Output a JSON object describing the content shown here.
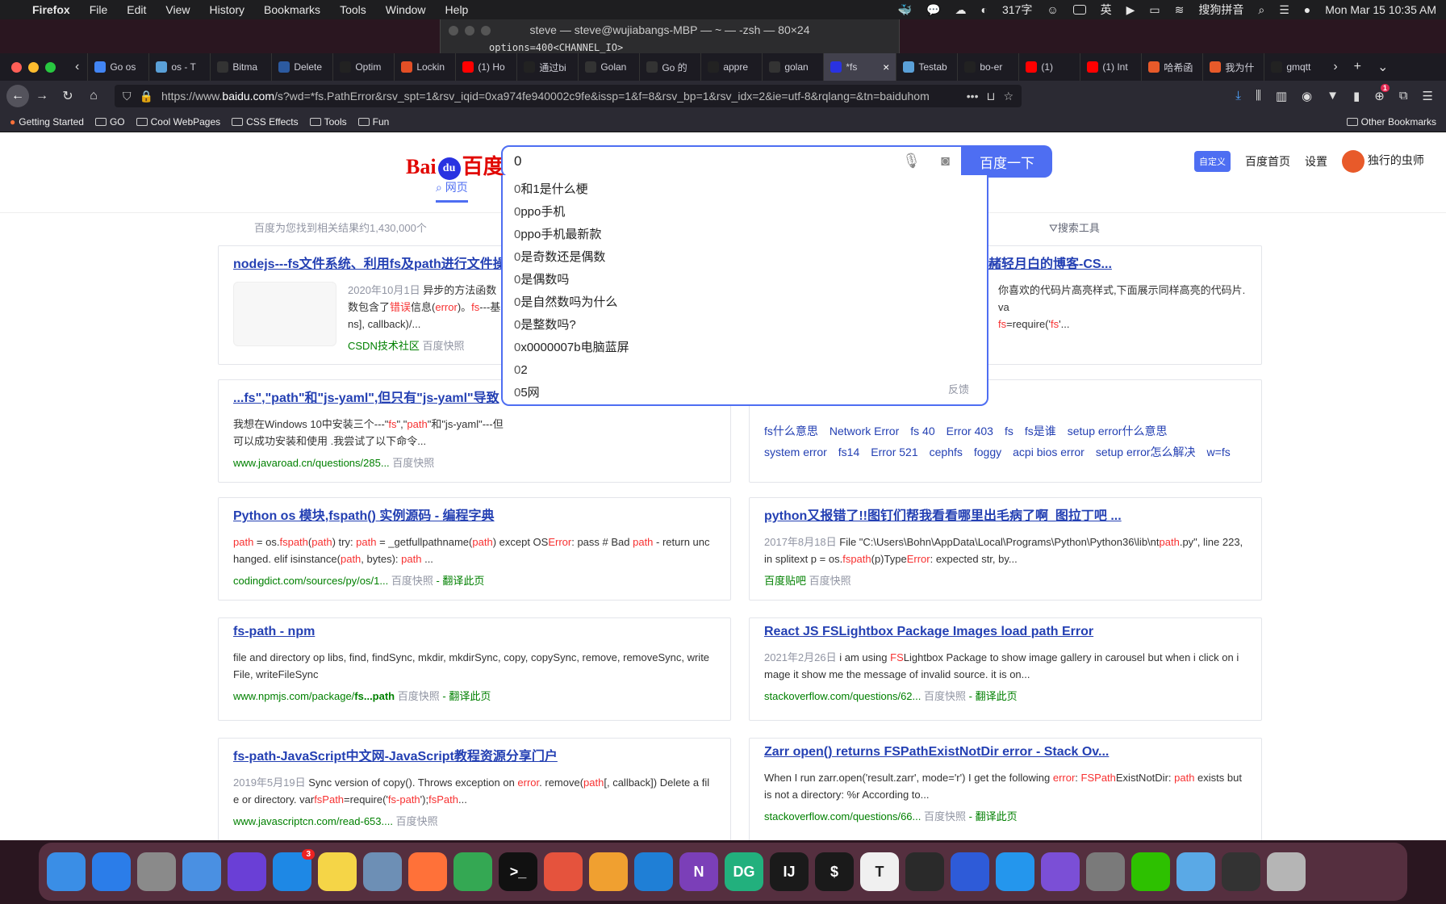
{
  "menubar": {
    "items": [
      "Firefox",
      "File",
      "Edit",
      "View",
      "History",
      "Bookmarks",
      "Tools",
      "Window",
      "Help"
    ],
    "char_count": "317字",
    "ime": "英",
    "sogou": "搜狗拼音",
    "datetime": "Mon Mar 15  10:35 AM"
  },
  "terminal": {
    "title": "steve — steve@wujiabangs-MBP — ~ — -zsh — 80×24",
    "line": "options=400<CHANNEL_IO>"
  },
  "tabs": [
    {
      "label": "Go os",
      "color": "#4285f4"
    },
    {
      "label": "os - T",
      "color": "#5aa0d8"
    },
    {
      "label": "Bitma",
      "color": "#333333"
    },
    {
      "label": "Delete",
      "color": "#2c5aa0"
    },
    {
      "label": "Optim",
      "color": "#222222"
    },
    {
      "label": "Lockin",
      "color": "#e34f26"
    },
    {
      "label": "(1) Ho",
      "color": "#ff0000"
    },
    {
      "label": "通过bi",
      "color": "#222222"
    },
    {
      "label": "Golan",
      "color": "#333333"
    },
    {
      "label": "Go 的",
      "color": "#333333"
    },
    {
      "label": "appre",
      "color": "#222222"
    },
    {
      "label": "golan",
      "color": "#333333"
    },
    {
      "label": "*fs",
      "color": "#2932e1"
    },
    {
      "label": "Testab",
      "color": "#5aa0d8"
    },
    {
      "label": "bo-er",
      "color": "#222222"
    },
    {
      "label": "(1)",
      "color": "#ff0000"
    },
    {
      "label": "(1) Int",
      "color": "#ff0000"
    },
    {
      "label": "哈希函",
      "color": "#e85a2a"
    },
    {
      "label": "我为什",
      "color": "#e85a2a"
    },
    {
      "label": "gmqtt",
      "color": "#222222"
    }
  ],
  "navbar": {
    "url_prefix": "https://www.",
    "url_domain": "baidu.com",
    "url_rest": "/s?wd=*fs.PathError&rsv_spt=1&rsv_iqid=0xa974fe940002c9fe&issp=1&f=8&rsv_bp=1&rsv_idx=2&ie=utf-8&rqlang=&tn=baiduhom",
    "badge": "1"
  },
  "bookmarks": [
    "Getting Started",
    "GO",
    "Cool WebPages",
    "CSS Effects",
    "Tools",
    "Fun"
  ],
  "other_bookmarks": "Other Bookmarks",
  "baidu": {
    "logo_left": "Bai",
    "logo_paw": "du",
    "logo_right": "百度",
    "query": "0",
    "search_button": "百度一下",
    "custom": "自定义",
    "home": "百度首页",
    "settings": "设置",
    "user": "独行的虫师",
    "tab_web": "网页",
    "result_count": "百度为您找到相关结果约1,430,000个",
    "search_tools": "搜索工具",
    "feedback": "反馈",
    "suggestions": [
      "和1是什么梗",
      "ppo手机",
      "ppo手机最新款",
      "是奇数还是偶数",
      "是偶数吗",
      "是自然数吗为什么",
      "是整数吗?",
      "x0000007b电脑蓝屏",
      "2",
      "5网"
    ]
  },
  "results": {
    "r1": {
      "title": "nodejs---fs文件系统、利用fs及path进行文件操",
      "date": "2020年10月1日",
      "snippet_a": "异步的方法函数",
      "snippet_b": "数包含了",
      "err": "错误",
      "snippet_c": "信息(",
      "err2": "error",
      "snippet_d": ")。",
      "fs": "fs",
      "snippet_e": "---基",
      "snippet_f": "ns], callback)/...",
      "source": "CSDN技术社区",
      "cache": "百度快照"
    },
    "r2": {
      "title": "浅赭轻月白的博客-CS...",
      "snippet_a": "你喜欢的代码片高亮样式,下面展示同样高亮的代码片. va",
      "fs": "fs",
      "snippet_b": "=require('",
      "fs2": "fs",
      "snippet_c": "'..."
    },
    "r3": {
      "title": "...fs\",\"path\"和\"js-yaml\",但只有\"js-yaml\"导致",
      "snippet_a": "我想在Windows 10中安装三个---\"",
      "fs": "fs",
      "snippet_b": "\",\"",
      "path": "path",
      "snippet_c": "\"和\"js-yaml\"---但",
      "snippet_d": "可以成功安装和使用 .我尝试了以下命令...",
      "source": "www.javaroad.cn/questions/285...",
      "cache": "百度快照"
    },
    "r4": {
      "related": [
        "fs什么意思",
        "Network Error",
        "fs 40",
        "Error 403",
        "fs",
        "fs是谁",
        "setup error什么意思",
        "system error",
        "fs14",
        "Error 521",
        "cephfs",
        "foggy",
        "acpi bios error",
        "setup error怎么解决",
        "w=fs"
      ]
    },
    "r5": {
      "title": "Python os 模块,fspath() 实例源码 - 编程字典",
      "p1": "path",
      "s1": " = os.",
      "p2": "fspath",
      "s2": "(",
      "p3": "path",
      "s3": ") try: ",
      "p4": "path",
      "s4": " = _getfullpathname(",
      "p5": "path",
      "s5": ") except OS",
      "e1": "Error",
      "s6": ": pass # Bad ",
      "p6": "path",
      "s7": " - return unc",
      "s8": "hanged. elif isinstance(",
      "p7": "path",
      "s9": ", bytes): ",
      "p8": "path",
      "s10": " ...",
      "source": "codingdict.com/sources/py/os/1...",
      "cache": "百度快照",
      "translate": "翻译此页"
    },
    "r6": {
      "title": "python又报错了!!图钉们帮我看看哪里出毛病了啊_图拉丁吧 ...",
      "date": "2017年8月18日",
      "s1": "File \"C:\\Users\\Bohn\\AppData\\Local\\Programs\\Python\\Python36\\lib\\nt",
      "p1": "path",
      "s2": ".py\", line 223,",
      "s3": "in splitext p = os.",
      "p2": "fspath",
      "s4": "(p)Type",
      "e1": "Error",
      "s5": ": expected str, by...",
      "source": "百度贴吧",
      "cache": "百度快照"
    },
    "r7": {
      "title": "fs-path - npm",
      "snippet": "file and directory op libs, find, findSync, mkdir, mkdirSync, copy, copySync, remove, removeSync, write",
      "snippet2": "File, writeFileSync",
      "source_a": "www.npmjs.com/package/",
      "source_b": "fs...path",
      "cache": "百度快照",
      "translate": "翻译此页"
    },
    "r8": {
      "title": "React JS FSLightbox Package Images load path Error",
      "date": "2021年2月26日",
      "s1": "i am using ",
      "fs": "FS",
      "s2": "Lightbox Package to show image gallery in carousel but when i click on i",
      "s3": "mage it show me the message of invalid source. it is on...",
      "source": "stackoverflow.com/questions/62...",
      "cache": "百度快照",
      "translate": "翻译此页"
    },
    "r9": {
      "title": "fs-path-JavaScript中文网-JavaScript教程资源分享门户",
      "date": "2019年5月19日",
      "s1": "Sync version of copy(). Throws exception on ",
      "e1": "error",
      "s2": ". remove(",
      "p1": "path",
      "s3": "[, callback]) Delete a fil",
      "s4": "e or directory. var",
      "f1": "fsPath",
      "s5": "=require('",
      "f2": "fs-path",
      "s6": "');",
      "f3": "fsPath",
      "s7": "...",
      "source": "www.javascriptcn.com/read-653....",
      "cache": "百度快照"
    },
    "r10": {
      "title": "Zarr open() returns FSPathExistNotDir error - Stack Ov...",
      "s1": "When I run zarr.open('result.zarr', mode='r') I get the following ",
      "e1": "error",
      "s2": ": ",
      "f1": "FSPath",
      "s3": "ExistNotDir: ",
      "p1": "path",
      "s4": " exists but",
      "s5": "is not a directory: %r According to...",
      "source": "stackoverflow.com/questions/66...",
      "cache": "百度快照",
      "translate": "翻译此页"
    }
  },
  "dock": [
    {
      "name": "finder-icon",
      "color": "#3a8ee6"
    },
    {
      "name": "safari-icon",
      "color": "#2b7de9"
    },
    {
      "name": "launchpad-icon",
      "color": "#8a8a8a"
    },
    {
      "name": "mail-icon",
      "color": "#4a90e2"
    },
    {
      "name": "siri-icon",
      "color": "#6a3fd6"
    },
    {
      "name": "app-store-icon",
      "color": "#1e88e5",
      "badge": "3"
    },
    {
      "name": "notes-icon",
      "color": "#f5d547"
    },
    {
      "name": "preview-icon",
      "color": "#6d8fb5"
    },
    {
      "name": "firefox-icon",
      "color": "#ff7139"
    },
    {
      "name": "chrome-icon",
      "color": "#34a853"
    },
    {
      "name": "terminal-icon",
      "color": "#111111",
      "label": ">_"
    },
    {
      "name": "remote-desktop-icon",
      "color": "#e5533d"
    },
    {
      "name": "pages-icon",
      "color": "#f0a030"
    },
    {
      "name": "vscode-icon",
      "color": "#1f7fd6"
    },
    {
      "name": "onenote-icon",
      "color": "#7b3fb8",
      "label": "N"
    },
    {
      "name": "datagrip-icon",
      "color": "#22b07d",
      "label": "DG"
    },
    {
      "name": "intellij-icon",
      "color": "#1a1a1a",
      "label": "IJ"
    },
    {
      "name": "iterm-icon",
      "color": "#1a1a1a",
      "label": "$"
    },
    {
      "name": "typora-icon",
      "color": "#f0f0f0",
      "label": "T"
    },
    {
      "name": "activity-monitor-icon",
      "color": "#2a2a2a"
    },
    {
      "name": "streaming-icon",
      "color": "#2e5bd8"
    },
    {
      "name": "docker-icon",
      "color": "#2496ed"
    },
    {
      "name": "github-desktop-icon",
      "color": "#7b4fd6"
    },
    {
      "name": "system-preferences-icon",
      "color": "#7a7a7a"
    },
    {
      "name": "wechat-icon",
      "color": "#2dc100"
    },
    {
      "name": "folder-icon",
      "color": "#5aa9e6"
    },
    {
      "name": "screenshots-icon",
      "color": "#333333"
    },
    {
      "name": "trash-icon",
      "color": "#b5b5b5"
    }
  ]
}
